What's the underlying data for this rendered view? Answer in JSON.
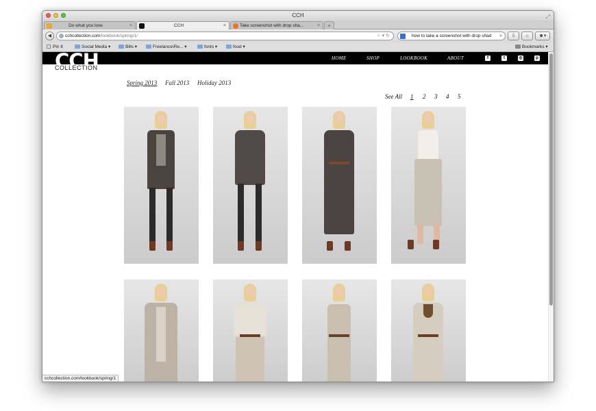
{
  "window": {
    "title": "CCH"
  },
  "tabs": [
    {
      "label": "Do what you love"
    },
    {
      "label": "CCH"
    },
    {
      "label": "Take screenshot with drop sha..."
    }
  ],
  "newtab": {
    "label": "+"
  },
  "urlbar": {
    "host": "cchcollection.com",
    "path": "/lookbook/spring/1/"
  },
  "searchbar": {
    "value": "how to take a screenshot with drop shad"
  },
  "bookmarks": {
    "items": [
      "Pin It",
      "Social Media",
      "Bills",
      "Freelance\\Re...",
      "fonts",
      "food"
    ],
    "menu_label": "Bookmarks"
  },
  "site": {
    "logo": "CCH",
    "logo_sub": "COLLECTION",
    "nav": [
      "HOME",
      "SHOP",
      "LOOKBOOK",
      "ABOUT"
    ],
    "social_icons": [
      "facebook-icon",
      "twitter-icon",
      "instagram-icon",
      "pinterest-icon"
    ]
  },
  "seasons": [
    "Spring 2013",
    "Fall 2013",
    "Holiday 2013"
  ],
  "pager": {
    "see_all": "See All",
    "pages": [
      "1",
      "2",
      "3",
      "4",
      "5"
    ]
  },
  "statusbar": {
    "text": "cchcollection.com/lookbook/spring/1"
  },
  "colors": {
    "header_bg": "#000000",
    "page_bg": "#ffffff",
    "photo_bg": "#d6d6d6"
  }
}
